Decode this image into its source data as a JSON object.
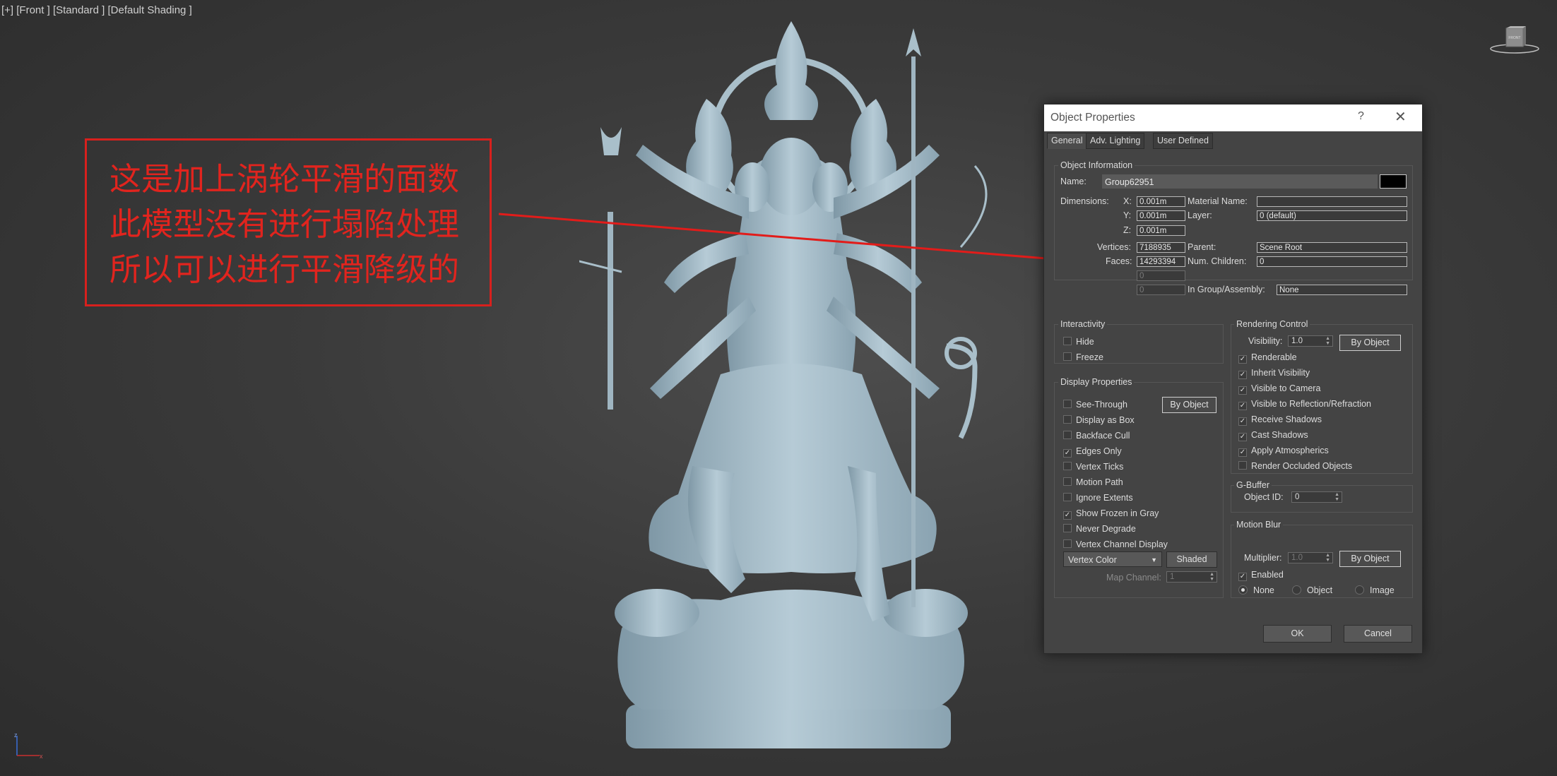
{
  "viewport": {
    "label": "[+] [Front ] [Standard ] [Default Shading ]",
    "viewcube_label": "FRONT"
  },
  "annotation": {
    "lines": [
      "这是加上涡轮平滑的面数",
      "此模型没有进行塌陷处理",
      "所以可以进行平滑降级的"
    ],
    "color": "#e1241e"
  },
  "dialog": {
    "title": "Object Properties",
    "help_glyph": "?",
    "close_glyph": "✕",
    "tabs": [
      "General",
      "Adv. Lighting",
      "User Defined"
    ],
    "object_info": {
      "title": "Object Information",
      "name_label": "Name:",
      "name_value": "Group62951",
      "dimensions_label": "Dimensions:",
      "x_label": "X:",
      "x_value": "0.001m",
      "y_label": "Y:",
      "y_value": "0.001m",
      "z_label": "Z:",
      "z_value": "0.001m",
      "material_name_label": "Material Name:",
      "material_name_value": "",
      "layer_label": "Layer:",
      "layer_value": "0 (default)",
      "vertices_label": "Vertices:",
      "vertices_value": "7188935",
      "faces_label": "Faces:",
      "faces_value": "14293394",
      "parent_label": "Parent:",
      "parent_value": "Scene Root",
      "num_children_label": "Num. Children:",
      "num_children_value": "0",
      "extra1_value": "0",
      "extra2_value": "0",
      "in_group_label": "In Group/Assembly:",
      "in_group_value": "None"
    },
    "interactivity": {
      "title": "Interactivity",
      "hide": "Hide",
      "freeze": "Freeze"
    },
    "display_properties": {
      "title": "Display Properties",
      "by_object": "By Object",
      "items": [
        {
          "label": "See-Through",
          "checked": false
        },
        {
          "label": "Display as Box",
          "checked": false
        },
        {
          "label": "Backface Cull",
          "checked": false
        },
        {
          "label": "Edges Only",
          "checked": true
        },
        {
          "label": "Vertex Ticks",
          "checked": false
        },
        {
          "label": "Motion Path",
          "checked": false
        },
        {
          "label": "Ignore Extents",
          "checked": false
        },
        {
          "label": "Show Frozen in Gray",
          "checked": true
        },
        {
          "label": "Never Degrade",
          "checked": false
        },
        {
          "label": "Vertex Channel Display",
          "checked": false
        }
      ],
      "vertex_color": "Vertex Color",
      "shaded": "Shaded",
      "map_channel_label": "Map Channel:",
      "map_channel_value": "1"
    },
    "rendering_control": {
      "title": "Rendering Control",
      "visibility_label": "Visibility:",
      "visibility_value": "1.0",
      "by_object": "By Object",
      "items": [
        {
          "label": "Renderable",
          "checked": true
        },
        {
          "label": "Inherit Visibility",
          "checked": true
        },
        {
          "label": "Visible to Camera",
          "checked": true
        },
        {
          "label": "Visible to Reflection/Refraction",
          "checked": true
        },
        {
          "label": "Receive Shadows",
          "checked": true
        },
        {
          "label": "Cast Shadows",
          "checked": true
        },
        {
          "label": "Apply Atmospherics",
          "checked": true
        },
        {
          "label": "Render Occluded Objects",
          "checked": false
        }
      ]
    },
    "gbuffer": {
      "title": "G-Buffer",
      "object_id_label": "Object ID:",
      "object_id_value": "0"
    },
    "motion_blur": {
      "title": "Motion Blur",
      "multiplier_label": "Multiplier:",
      "multiplier_value": "1.0",
      "by_object": "By Object",
      "enabled": "Enabled",
      "enabled_checked": true,
      "options": [
        "None",
        "Object",
        "Image"
      ],
      "selected": "None"
    },
    "ok": "OK",
    "cancel": "Cancel"
  }
}
